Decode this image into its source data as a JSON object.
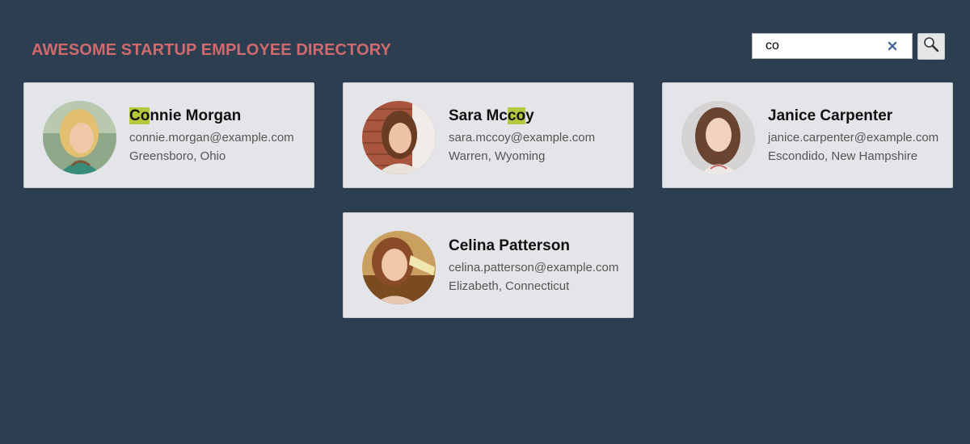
{
  "header": {
    "title": "AWESOME STARTUP EMPLOYEE DIRECTORY"
  },
  "search": {
    "value": "co",
    "clear_icon": "close-icon",
    "button_icon": "magnifier-icon"
  },
  "highlight_color": "#b5c73d",
  "employees": [
    {
      "name_before": "",
      "name_match": "Co",
      "name_after": "nnie Morgan",
      "email": "connie.morgan@example.com",
      "location": "Greensboro, Ohio"
    },
    {
      "name_before": "Sara Mc",
      "name_match": "co",
      "name_after": "y",
      "email": "sara.mccoy@example.com",
      "location": "Warren, Wyoming"
    },
    {
      "name_before": "Janice Carpenter",
      "name_match": "",
      "name_after": "",
      "email": "janice.carpenter@example.com",
      "location": "Escondido, New Hampshire"
    },
    {
      "name_before": "Celina Patterson",
      "name_match": "",
      "name_after": "",
      "email": "celina.patterson@example.com",
      "location": "Elizabeth, Connecticut"
    }
  ]
}
